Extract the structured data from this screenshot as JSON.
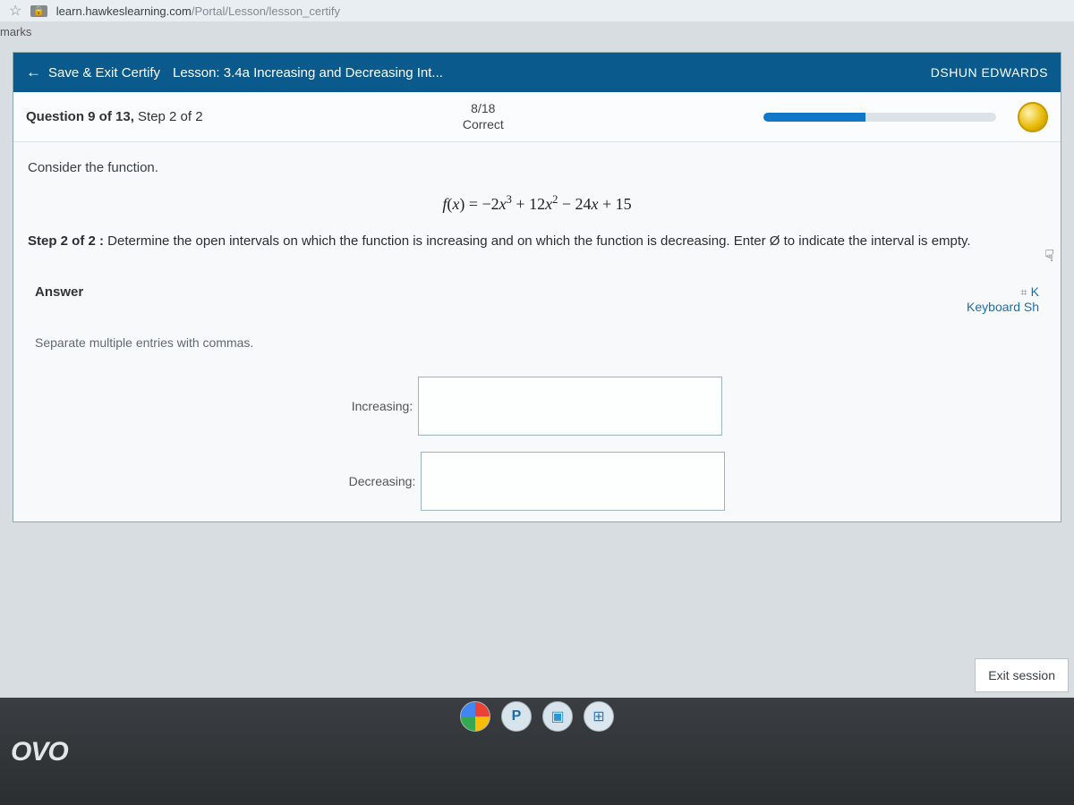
{
  "browser": {
    "url_host": "learn.hawkeslearning.com",
    "url_path": "/Portal/Lesson/lesson_certify",
    "bookmarks_label": "marks"
  },
  "header": {
    "save_exit": "Save & Exit Certify",
    "lesson": "Lesson: 3.4a Increasing and Decreasing Int...",
    "user": "DSHUN EDWARDS"
  },
  "subheader": {
    "question_prefix": "Question 9 of 13,",
    "question_step": " Step 2 of 2",
    "score": "8/18",
    "score_label": "Correct"
  },
  "question": {
    "consider": "Consider the function.",
    "equation_plain": "f(x) = −2x³ + 12x² − 24x + 15",
    "step_label": "Step 2 of 2 :",
    "step_text": " Determine the open intervals on which the function is increasing and on which the function is decreasing. Enter Ø to indicate the interval is empty."
  },
  "answer": {
    "heading": "Answer",
    "keypad_label": "K",
    "keyboard_link": "Keyboard Sh",
    "separator_note": "Separate multiple entries with commas.",
    "increasing_label": "Increasing:",
    "decreasing_label": "Decreasing:",
    "increasing_value": "",
    "decreasing_value": ""
  },
  "footer": {
    "exit_session": "Exit session",
    "logo": "OVO"
  }
}
